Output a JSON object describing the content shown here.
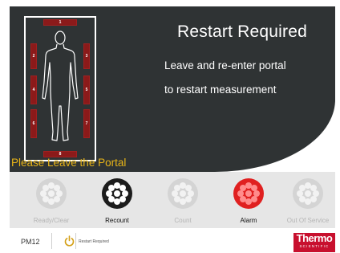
{
  "header": {
    "title": "Restart Required",
    "message_line1": "Leave and re-enter portal",
    "message_line2": "to restart measurement",
    "instruction": "Please Leave the Portal"
  },
  "detectors": [
    "1",
    "2",
    "3",
    "4",
    "5",
    "6",
    "7",
    "8"
  ],
  "status_buttons": [
    {
      "label": "Ready/Clear",
      "state": "inactive"
    },
    {
      "label": "Recount",
      "state": "active"
    },
    {
      "label": "Count",
      "state": "inactive"
    },
    {
      "label": "Alarm",
      "state": "alarm"
    },
    {
      "label": "Out Of Service",
      "state": "inactive"
    }
  ],
  "footer": {
    "portal_id": "PM12",
    "status_text": "Restart Required",
    "brand_name": "Thermo",
    "brand_sub": "SCIENTIFIC"
  },
  "colors": {
    "panel": "#2f3334",
    "detector": "#8b1a1a",
    "instruction": "#e8b418",
    "alarm": "#e02020",
    "brand": "#c8102e"
  },
  "icons": [
    "person-silhouette-icon",
    "power-icon",
    "status-lamp-icon"
  ]
}
